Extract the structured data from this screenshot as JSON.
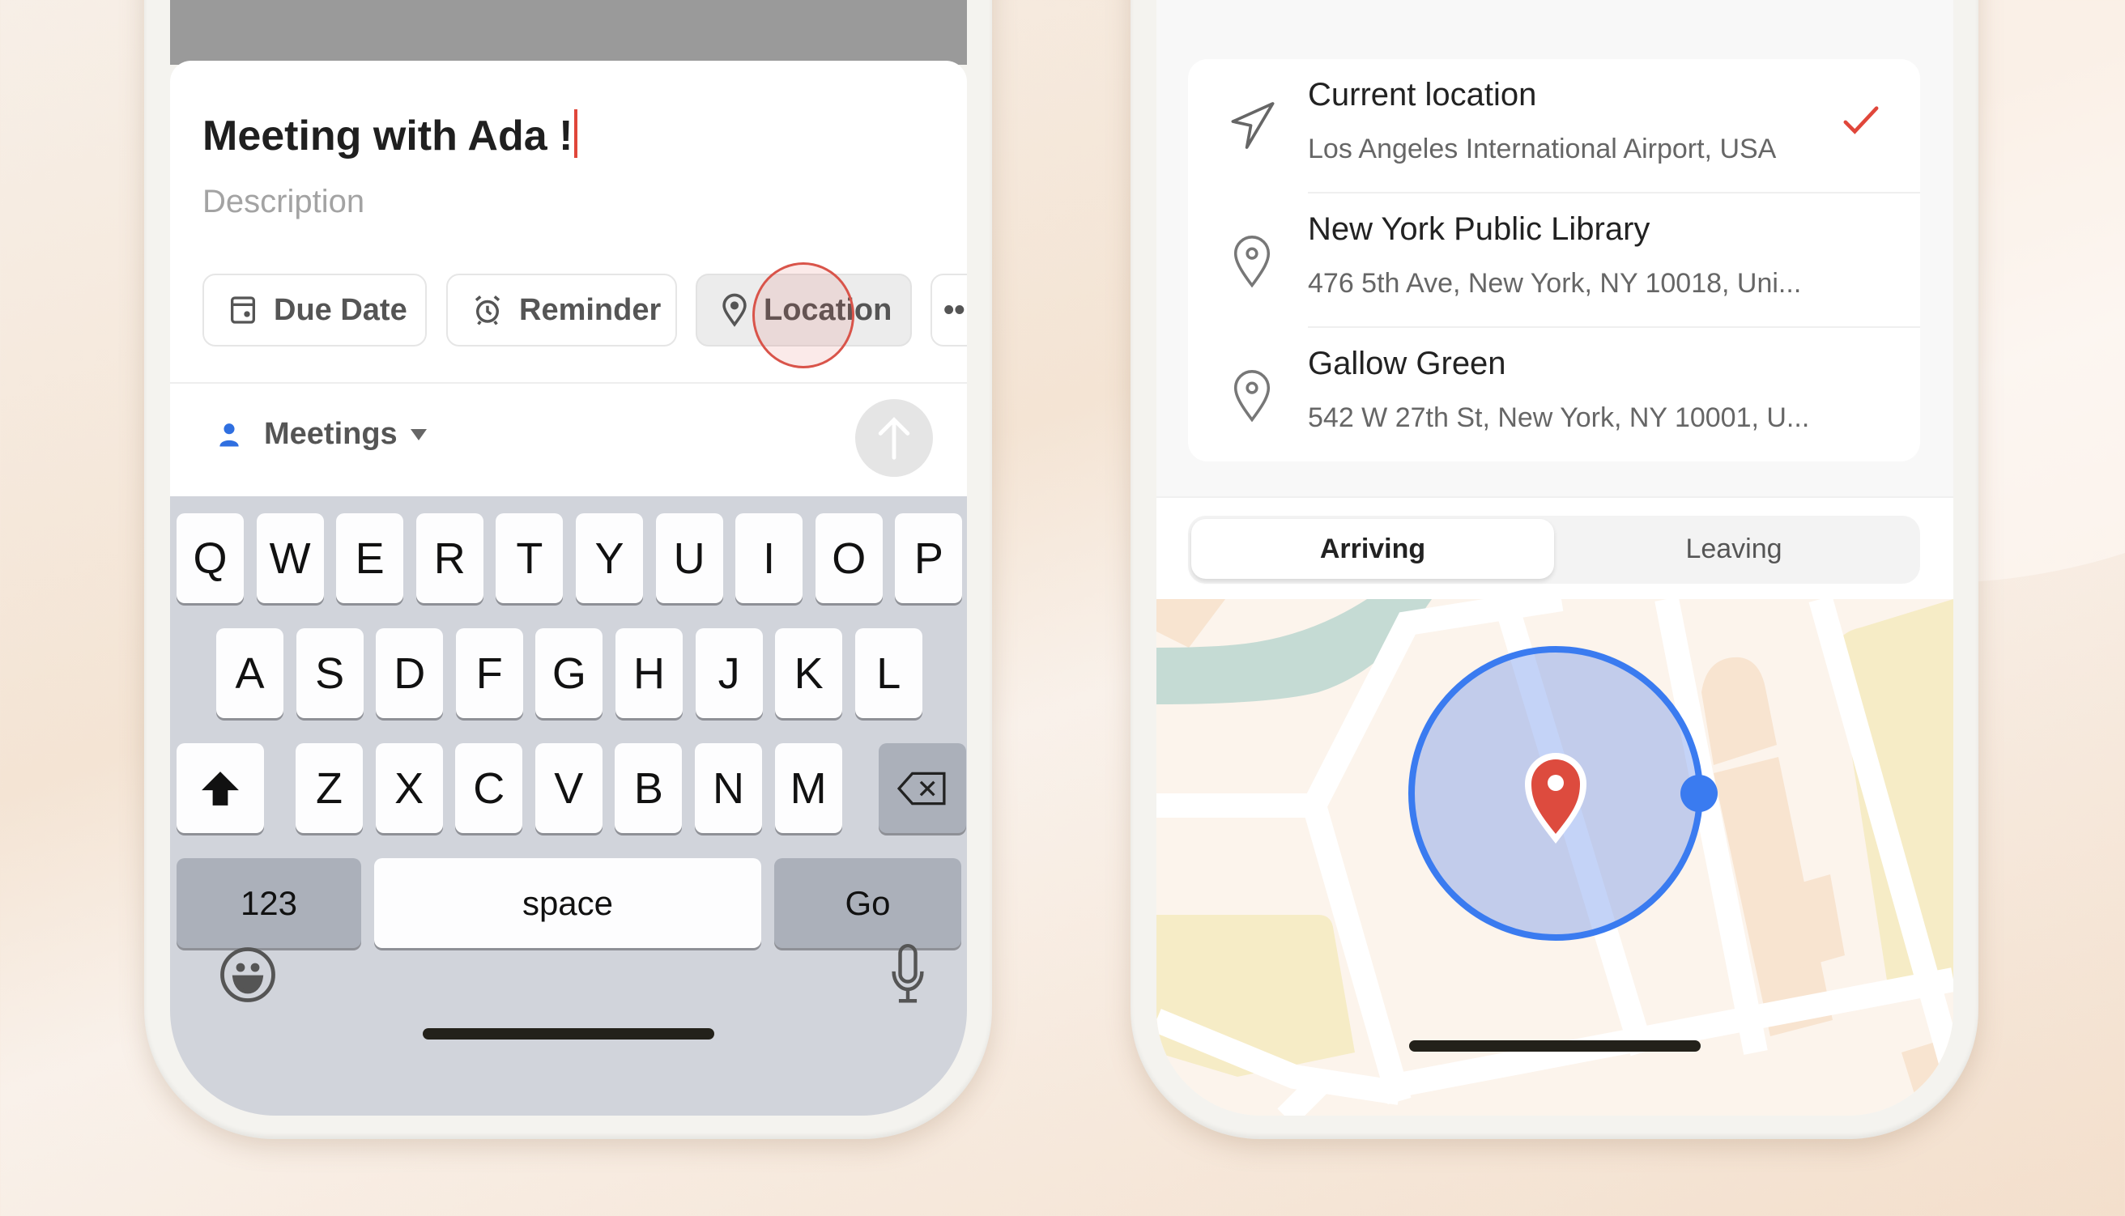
{
  "task_editor": {
    "title_value": "Meeting with Ada !",
    "description_placeholder": "Description",
    "chips": [
      {
        "label": "Due Date",
        "icon": "calendar-icon"
      },
      {
        "label": "Reminder",
        "icon": "alarm-clock-icon"
      },
      {
        "label": "Location",
        "icon": "location-pin-icon",
        "active": true
      },
      {
        "label": "",
        "icon": "more-icon"
      }
    ],
    "project": {
      "label": "Meetings",
      "icon": "person-icon",
      "color": "#2f6fe0"
    },
    "send_icon": "arrow-up-icon"
  },
  "keyboard": {
    "row1": [
      "Q",
      "W",
      "E",
      "R",
      "T",
      "Y",
      "U",
      "I",
      "O",
      "P"
    ],
    "row2": [
      "A",
      "S",
      "D",
      "F",
      "G",
      "H",
      "J",
      "K",
      "L"
    ],
    "row3": [
      "Z",
      "X",
      "C",
      "V",
      "B",
      "N",
      "M"
    ],
    "numbers_label": "123",
    "space_label": "space",
    "go_label": "Go",
    "shift_icon": "shift-icon",
    "delete_icon": "backspace-icon",
    "emoji_icon": "emoji-icon",
    "mic_icon": "microphone-icon"
  },
  "location_picker": {
    "items": [
      {
        "title": "Current location",
        "subtitle": "Los Angeles International Airport, USA",
        "icon": "navigation-arrow-icon",
        "selected": true
      },
      {
        "title": "New York Public Library",
        "subtitle": "476 5th Ave, New York, NY 10018, Uni...",
        "icon": "location-pin-icon",
        "selected": false
      },
      {
        "title": "Gallow Green",
        "subtitle": "542 W 27th St, New York, NY 10001, U...",
        "icon": "location-pin-icon",
        "selected": false
      }
    ],
    "segments": [
      {
        "label": "Arriving",
        "active": true
      },
      {
        "label": "Leaving",
        "active": false
      }
    ]
  },
  "colors": {
    "accent_red": "#e0463a",
    "geofence_blue": "#3a7bf0",
    "keyboard_bg": "#d1d4db"
  }
}
